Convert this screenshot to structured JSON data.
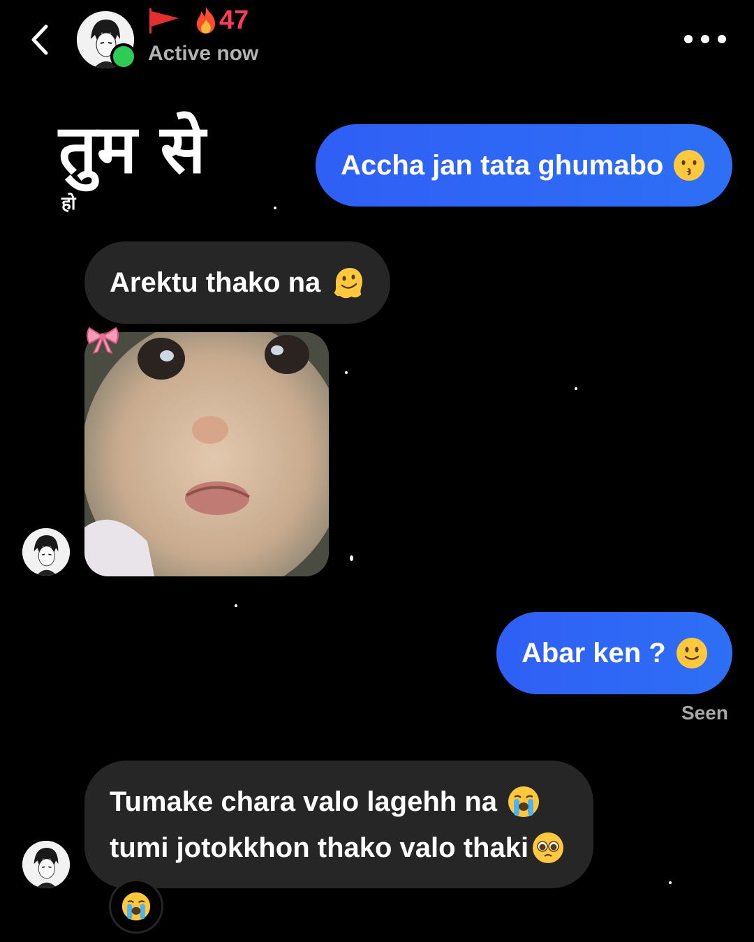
{
  "header": {
    "streak_count": "47",
    "status": "Active now"
  },
  "overlay": {
    "hindi_main": "तुम से",
    "hindi_small": "हो"
  },
  "messages": [
    {
      "sender": "me",
      "text": "Accha jan tata ghumabo",
      "emoji": "kissing-face-icon"
    },
    {
      "sender": "them",
      "text": "Arektu thako na",
      "emoji": "melting-face-icon"
    },
    {
      "sender": "them",
      "type": "photo",
      "sticker": "pink-bow-icon"
    },
    {
      "sender": "me",
      "text": "Abar ken ?",
      "emoji": "slightly-smiling-face-icon"
    },
    {
      "sender": "them",
      "lines": [
        "Tumake chara valo lagehh na",
        "tumi jotokkhon thako valo thaki"
      ],
      "emojis": [
        "loudly-crying-face-icon",
        "pleading-face-icon"
      ],
      "reaction": "loudly-crying-face-icon"
    }
  ],
  "seen_label": "Seen",
  "colors": {
    "background": "#000000",
    "outgoing_bubble": "#2f5ff5",
    "incoming_bubble": "#262626",
    "streak": "#ff3b5c",
    "online": "#2ecc55"
  }
}
